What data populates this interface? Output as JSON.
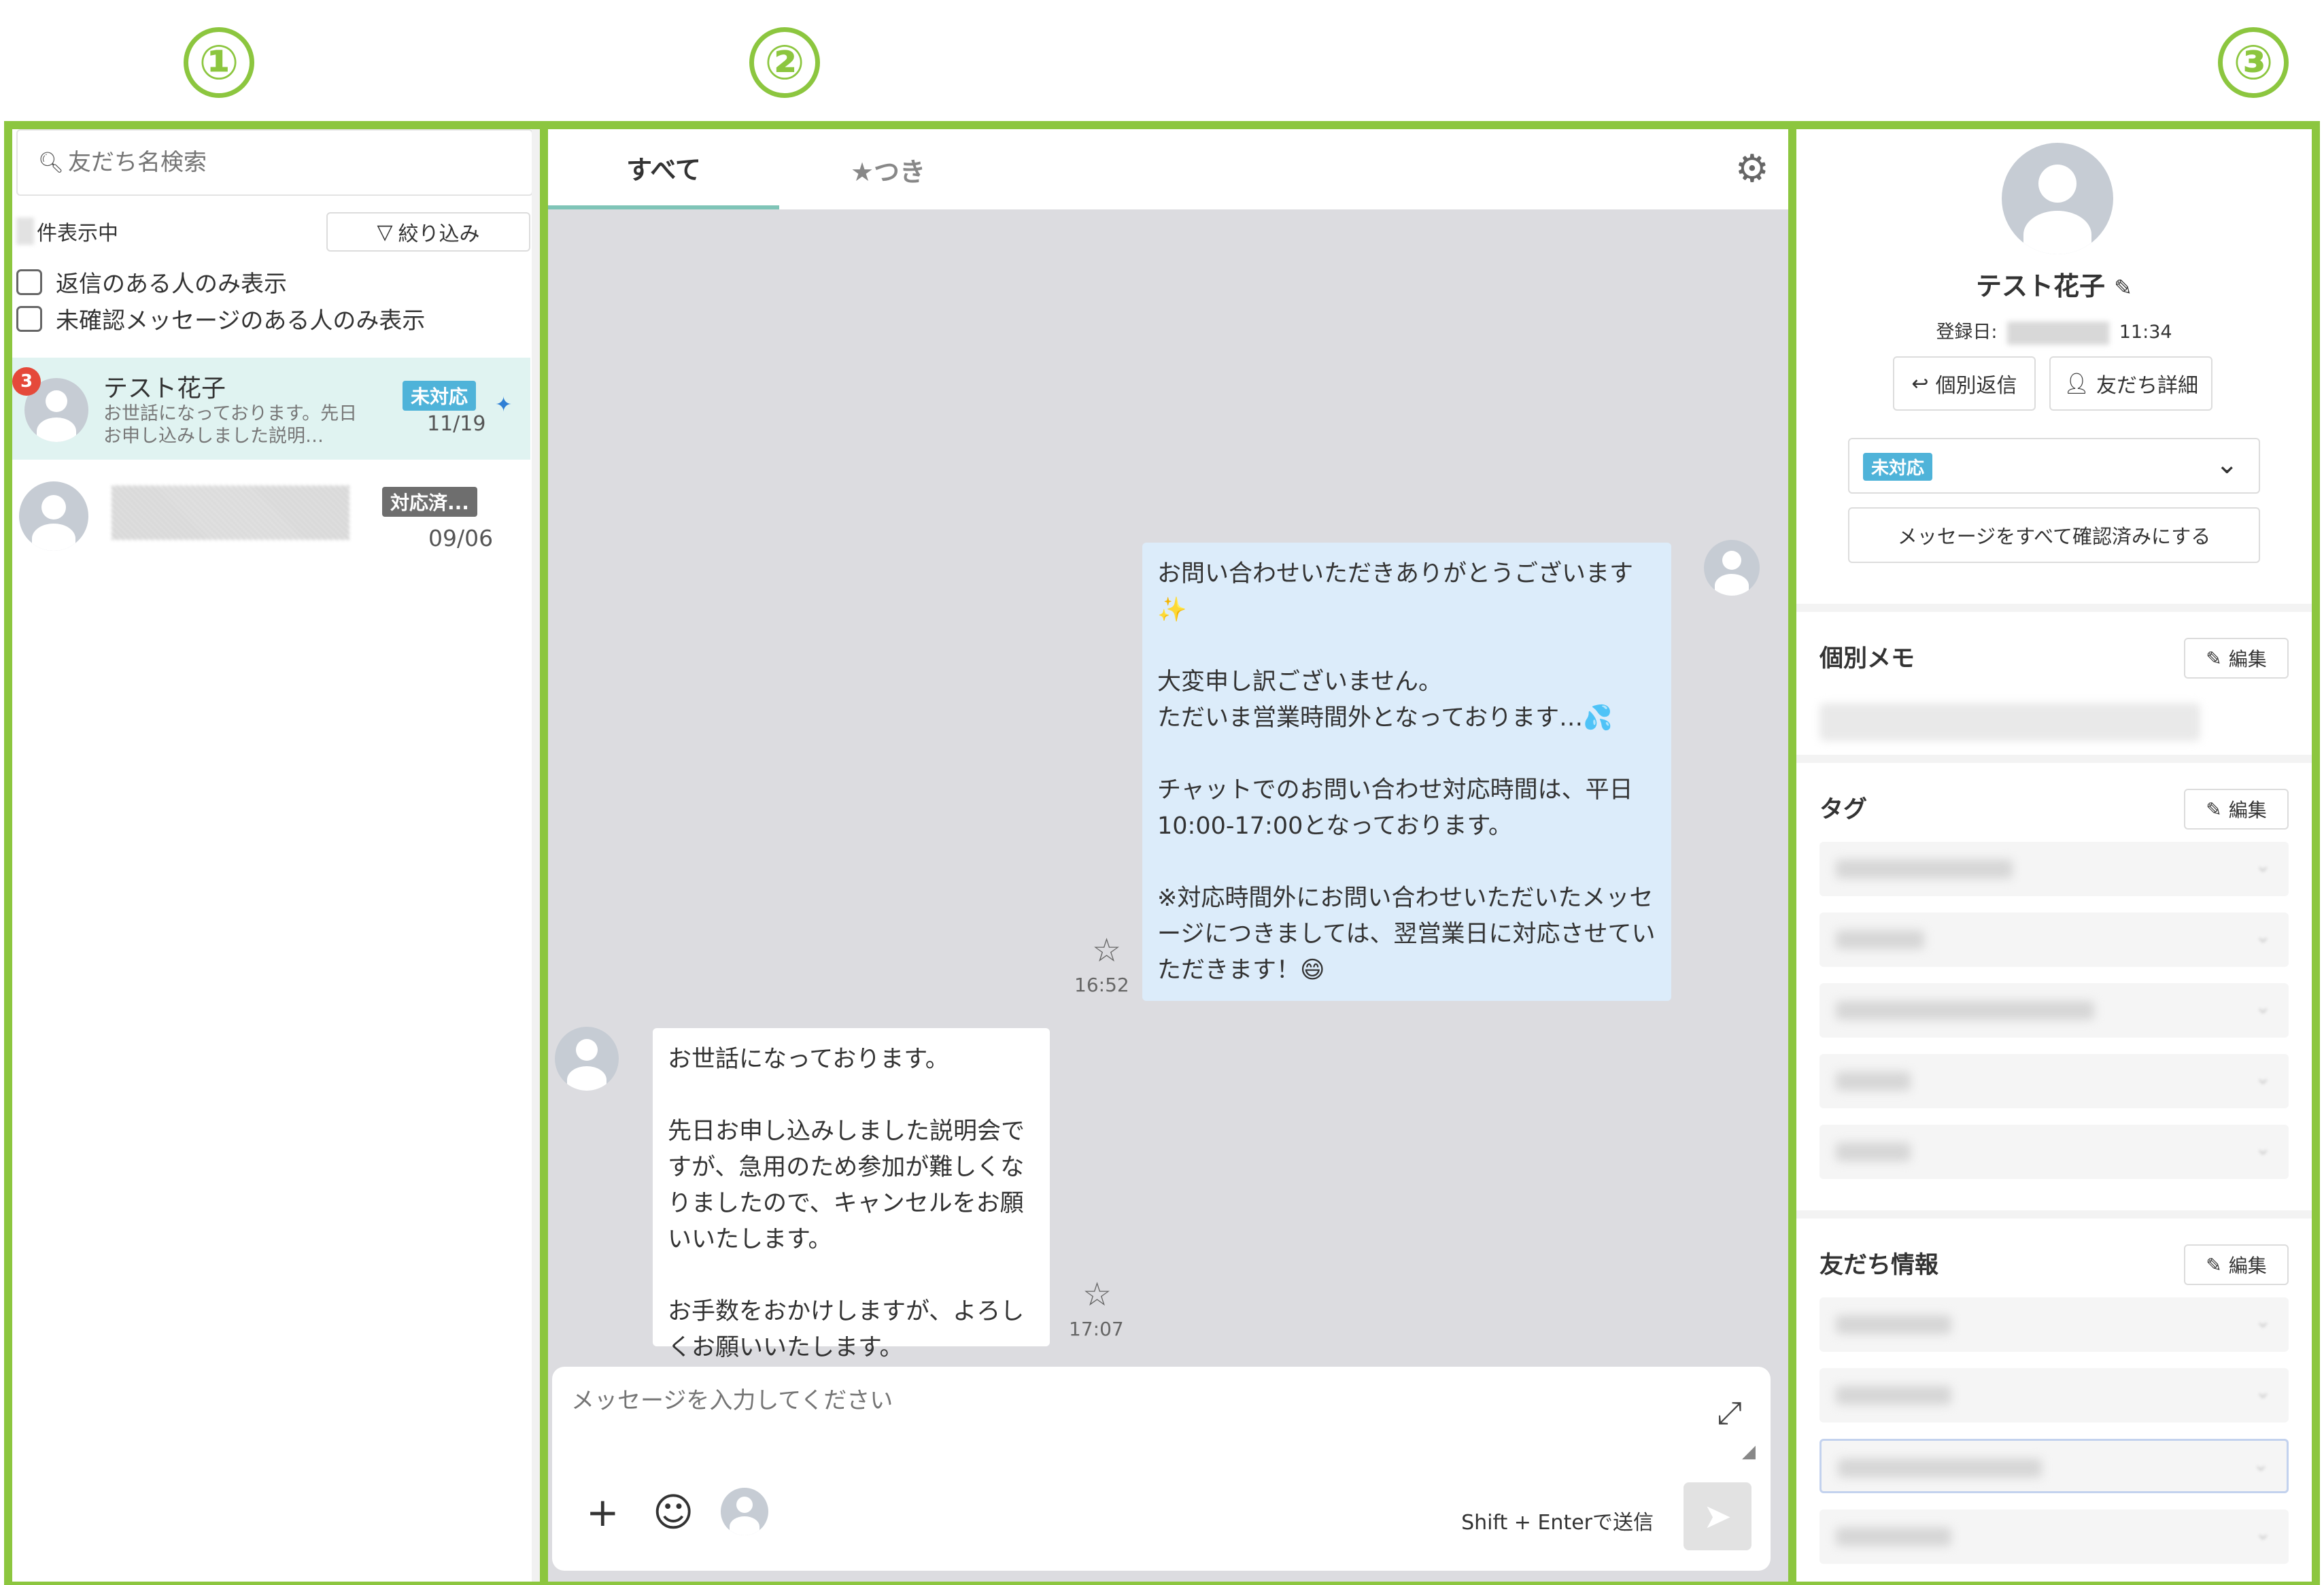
{
  "section_markers": [
    "①",
    "②",
    "③"
  ],
  "friend_list": {
    "search_placeholder": "友だち名検索",
    "count_suffix": "件表示中",
    "filter_label": "絞り込み",
    "reply_only_label": "返信のある人のみ表示",
    "unconfirmed_only_label": "未確認メッセージのある人のみ表示",
    "friends": [
      {
        "name": "テスト花子",
        "preview": "お世話になっております。先日お申し込みしました説明…",
        "status": "未対応",
        "date": "11/19",
        "unread": "3",
        "pinned": true
      },
      {
        "status": "対応済...",
        "date": "09/06"
      }
    ]
  },
  "chat": {
    "tab_all": "すべて",
    "tab_starred": "★つき",
    "messages": [
      {
        "direction": "out",
        "text": "お問い合わせいただきありがとうございます✨\n\n大変申し訳ございません。\nただいま営業時間外となっております…💦\n\nチャットでのお問い合わせ対応時間は、平日10:00-17:00となっております。\n\n※対応時間外にお問い合わせいただいたメッセージにつきましては、翌営業日に対応させていただきます！😄",
        "time": "16:52"
      },
      {
        "direction": "in",
        "text": "お世話になっております。\n\n先日お申し込みしました説明会ですが、急用のため参加が難しくなりましたので、キャンセルをお願いいたします。\n\nお手数をおかけしますが、よろしくお願いいたします。",
        "time": "17:07"
      }
    ],
    "composer_placeholder": "メッセージを入力してください",
    "send_hint": "Shift + Enterで送信"
  },
  "detail": {
    "name": "テスト花子",
    "registered_label": "登録日:",
    "registered_time": "11:34",
    "reply_button": "個別返信",
    "detail_button": "友だち詳細",
    "status_value": "未対応",
    "confirm_all_button": "メッセージをすべて確認済みにする",
    "memo_title": "個別メモ",
    "tags_title": "タグ",
    "info_title": "友だち情報",
    "edit_label": "編集"
  },
  "colors": {
    "frame_green": "#8cc63f",
    "status_open": "#4fb3d9",
    "status_done": "#6e6e6e",
    "unread_red": "#e5493a",
    "outgoing_bubble": "#dcecfa",
    "active_row": "#e0f3f1",
    "tab_underline": "#7fc4b7"
  },
  "icons": [
    "search-icon",
    "filter-icon",
    "pin-icon",
    "gear-icon",
    "star-icon",
    "expand-icon",
    "plus-icon",
    "smile-icon",
    "send-icon",
    "pencil-icon",
    "reply-icon",
    "person-icon",
    "chevron-down-icon"
  ]
}
